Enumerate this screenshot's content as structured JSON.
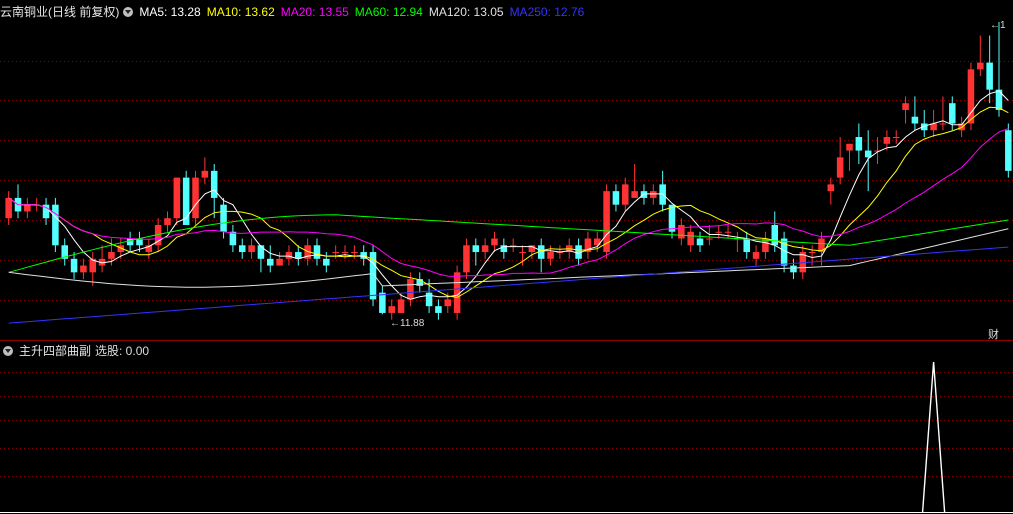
{
  "main_header": {
    "title": "云南铜业(日线 前复权)",
    "ma_labels": [
      {
        "text": "MA5: 13.28",
        "color": "#ffffff"
      },
      {
        "text": "MA10: 13.62",
        "color": "#ffff00"
      },
      {
        "text": "MA20: 13.55",
        "color": "#ff00ff"
      },
      {
        "text": "MA60: 12.94",
        "color": "#00ff00"
      },
      {
        "text": "MA120: 13.05",
        "color": "#e0e0e0"
      },
      {
        "text": "MA250: 12.76",
        "color": "#3333ff"
      }
    ]
  },
  "sub_header": {
    "title": "主升四部曲副",
    "indicator": "选股: 0.00"
  },
  "badge": "财",
  "annotations": {
    "low": "11.88",
    "high_prefix": "1"
  },
  "colors": {
    "up": "#ff3333",
    "down": "#54ffff",
    "grid": "#8b0000",
    "border": "#8b0000"
  },
  "chart_data": [
    {
      "type": "candlestick",
      "ylim": [
        11.5,
        16.2
      ],
      "grid": true,
      "candles": [
        [
          13.3,
          13.7,
          13.6,
          13.2
        ],
        [
          13.6,
          13.8,
          13.4,
          13.3
        ],
        [
          13.4,
          13.6,
          13.5,
          13.3
        ],
        [
          13.5,
          13.6,
          13.5,
          13.4
        ],
        [
          13.5,
          13.6,
          13.3,
          13.2
        ],
        [
          13.5,
          13.6,
          12.9,
          12.8
        ],
        [
          12.9,
          13.0,
          12.7,
          12.6
        ],
        [
          12.7,
          12.8,
          12.5,
          12.4
        ],
        [
          12.5,
          12.7,
          12.6,
          12.4
        ],
        [
          12.5,
          12.8,
          12.7,
          12.3
        ],
        [
          12.6,
          12.9,
          12.7,
          12.5
        ],
        [
          12.7,
          13.0,
          12.8,
          12.6
        ],
        [
          12.8,
          13.0,
          12.9,
          12.7
        ],
        [
          13.0,
          13.1,
          12.9,
          12.8
        ],
        [
          13.0,
          13.1,
          12.9,
          12.8
        ],
        [
          12.8,
          13.0,
          12.9,
          12.7
        ],
        [
          12.9,
          13.3,
          13.2,
          12.8
        ],
        [
          13.2,
          13.4,
          13.3,
          13.1
        ],
        [
          13.3,
          13.9,
          13.9,
          13.2
        ],
        [
          13.9,
          14.0,
          13.2,
          13.2
        ],
        [
          13.3,
          14.0,
          13.9,
          13.2
        ],
        [
          13.9,
          14.2,
          14.0,
          13.8
        ],
        [
          14.0,
          14.1,
          13.6,
          13.3
        ],
        [
          13.5,
          13.6,
          13.1,
          13.0
        ],
        [
          13.1,
          13.2,
          12.9,
          12.8
        ],
        [
          12.9,
          13.0,
          12.8,
          12.7
        ],
        [
          12.8,
          13.0,
          12.9,
          12.7
        ],
        [
          12.9,
          12.9,
          12.7,
          12.5
        ],
        [
          12.7,
          12.9,
          12.6,
          12.5
        ],
        [
          12.6,
          12.8,
          12.7,
          12.6
        ],
        [
          12.7,
          12.9,
          12.8,
          12.6
        ],
        [
          12.8,
          12.9,
          12.7,
          12.6
        ],
        [
          12.7,
          13.0,
          12.9,
          12.6
        ],
        [
          12.9,
          13.0,
          12.7,
          12.6
        ],
        [
          12.7,
          12.8,
          12.6,
          12.5
        ],
        [
          12.8,
          12.9,
          12.8,
          12.7
        ],
        [
          12.8,
          12.9,
          12.8,
          12.7
        ],
        [
          12.8,
          12.9,
          12.8,
          12.7
        ],
        [
          12.8,
          12.9,
          12.7,
          12.6
        ],
        [
          12.8,
          12.9,
          12.1,
          12.0
        ],
        [
          12.2,
          12.3,
          11.9,
          11.88
        ],
        [
          11.9,
          12.1,
          12.0,
          11.8
        ],
        [
          11.9,
          12.2,
          12.1,
          11.9
        ],
        [
          12.1,
          12.5,
          12.4,
          12.0
        ],
        [
          12.4,
          12.5,
          12.3,
          12.2
        ],
        [
          12.2,
          12.4,
          12.0,
          11.9
        ],
        [
          12.0,
          12.1,
          11.9,
          11.8
        ],
        [
          12.0,
          12.2,
          12.1,
          11.9
        ],
        [
          11.9,
          12.6,
          12.5,
          11.8
        ],
        [
          12.5,
          13.0,
          12.9,
          12.4
        ],
        [
          12.9,
          13.0,
          12.8,
          12.6
        ],
        [
          12.8,
          13.0,
          12.9,
          12.7
        ],
        [
          12.9,
          13.1,
          13.0,
          12.8
        ],
        [
          12.9,
          13.0,
          12.8,
          12.7
        ],
        [
          12.9,
          13.0,
          12.9,
          12.8
        ],
        [
          12.8,
          12.9,
          12.8,
          12.6
        ],
        [
          12.8,
          12.9,
          12.9,
          12.7
        ],
        [
          12.9,
          13.0,
          12.7,
          12.5
        ],
        [
          12.7,
          12.9,
          12.8,
          12.6
        ],
        [
          12.8,
          12.9,
          12.8,
          12.7
        ],
        [
          12.8,
          13.0,
          12.9,
          12.7
        ],
        [
          12.9,
          13.0,
          12.7,
          12.6
        ],
        [
          12.8,
          13.1,
          13.0,
          12.7
        ],
        [
          12.9,
          13.1,
          13.0,
          12.8
        ],
        [
          12.8,
          13.8,
          13.7,
          12.7
        ],
        [
          13.7,
          13.8,
          13.5,
          13.4
        ],
        [
          13.5,
          13.9,
          13.8,
          13.4
        ],
        [
          13.6,
          14.1,
          13.7,
          13.6
        ],
        [
          13.7,
          13.8,
          13.6,
          13.5
        ],
        [
          13.6,
          13.8,
          13.7,
          13.5
        ],
        [
          13.8,
          14.0,
          13.5,
          13.4
        ],
        [
          13.5,
          13.5,
          13.1,
          13.0
        ],
        [
          13.0,
          13.3,
          13.2,
          12.9
        ],
        [
          12.9,
          13.2,
          13.1,
          12.8
        ],
        [
          13.0,
          13.1,
          12.9,
          12.8
        ],
        [
          13.0,
          13.2,
          13.0,
          12.9
        ],
        [
          13.1,
          13.2,
          13.1,
          13.0
        ],
        [
          13.1,
          13.2,
          13.1,
          13.0
        ],
        [
          13.0,
          13.1,
          13.0,
          12.8
        ],
        [
          13.0,
          13.1,
          12.8,
          12.7
        ],
        [
          12.7,
          12.9,
          12.8,
          12.6
        ],
        [
          12.8,
          13.1,
          13.0,
          12.7
        ],
        [
          13.2,
          13.4,
          12.9,
          12.8
        ],
        [
          13.0,
          13.1,
          12.6,
          12.5
        ],
        [
          12.6,
          12.7,
          12.5,
          12.4
        ],
        [
          12.5,
          12.9,
          12.8,
          12.4
        ],
        [
          12.8,
          12.9,
          12.8,
          12.6
        ],
        [
          12.8,
          13.1,
          13.0,
          12.6
        ],
        [
          13.7,
          13.9,
          13.8,
          13.5
        ],
        [
          13.9,
          14.5,
          14.2,
          13.8
        ],
        [
          14.3,
          14.4,
          14.4,
          14.0
        ],
        [
          14.5,
          14.7,
          14.3,
          14.1
        ],
        [
          14.3,
          14.6,
          14.2,
          13.7
        ],
        [
          14.3,
          14.5,
          14.3,
          14.1
        ],
        [
          14.4,
          14.6,
          14.5,
          14.3
        ],
        [
          14.5,
          14.6,
          14.5,
          14.4
        ],
        [
          14.9,
          15.1,
          15.0,
          14.7
        ],
        [
          14.8,
          15.1,
          14.7,
          14.6
        ],
        [
          14.7,
          14.9,
          14.6,
          14.5
        ],
        [
          14.6,
          14.9,
          14.7,
          14.5
        ],
        [
          14.7,
          15.1,
          14.7,
          14.6
        ],
        [
          15.0,
          15.1,
          14.7,
          14.6
        ],
        [
          14.6,
          14.8,
          14.7,
          14.5
        ],
        [
          14.7,
          15.6,
          15.5,
          14.6
        ],
        [
          15.5,
          16.0,
          15.6,
          15.4
        ],
        [
          15.6,
          16.0,
          15.2,
          15.0
        ],
        [
          15.2,
          16.2,
          14.9,
          14.8
        ],
        [
          14.6,
          14.7,
          14.0,
          13.9
        ]
      ],
      "ma": [
        {
          "name": "MA5",
          "color": "#ffffff"
        },
        {
          "name": "MA10",
          "color": "#ffff00"
        },
        {
          "name": "MA20",
          "color": "#ff00ff"
        },
        {
          "name": "MA60",
          "color": "#00ff00"
        },
        {
          "name": "MA120",
          "color": "#e0e0e0"
        },
        {
          "name": "MA250",
          "color": "#3333ff"
        }
      ]
    },
    {
      "type": "line",
      "ylim": [
        0,
        1
      ],
      "values_index_start": 0,
      "spike_index": 99,
      "values": [
        0,
        1,
        0
      ]
    }
  ]
}
